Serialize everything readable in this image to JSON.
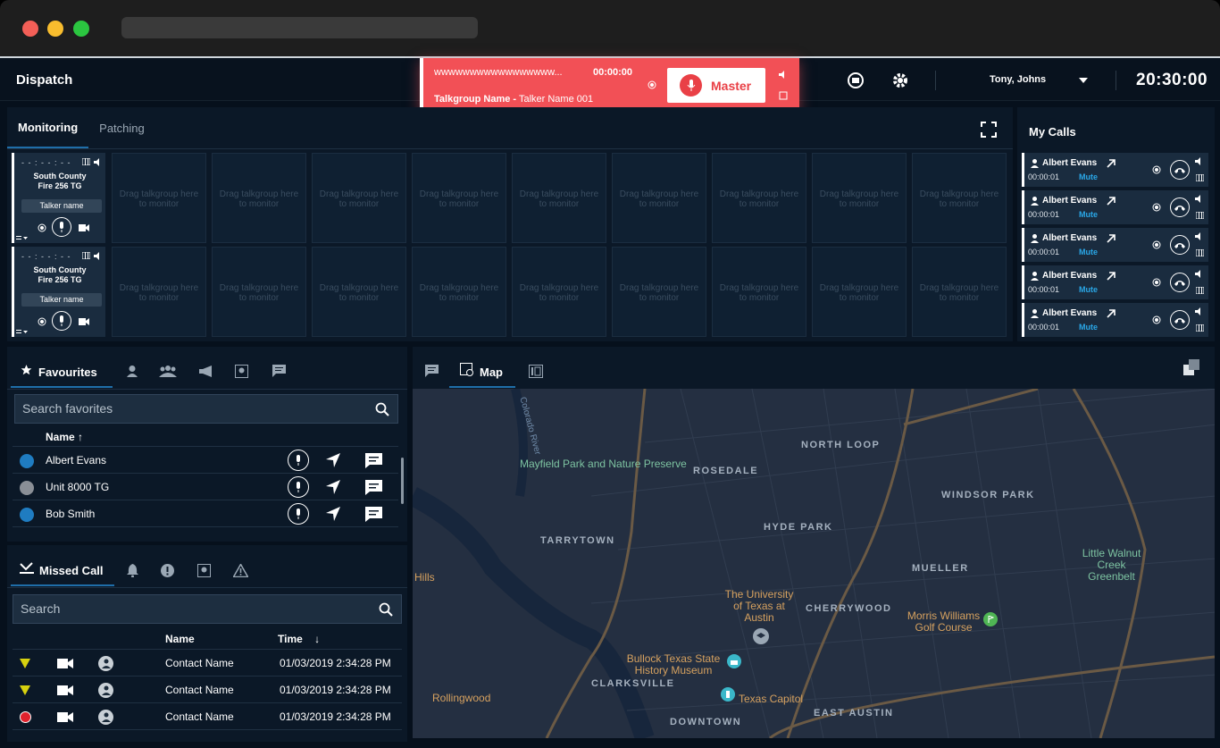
{
  "app": {
    "title": "Dispatch"
  },
  "header": {
    "user": "Tony, Johns",
    "clock": "20:30:00"
  },
  "active_call": {
    "number": "wwwwwwwwwwwwwwwww...",
    "timer": "00:00:00",
    "talkgroup_label": "Talkgroup Name -",
    "talker": "Talker Name 001",
    "master_label": "Master"
  },
  "monitoring": {
    "tabs": [
      {
        "label": "Monitoring"
      },
      {
        "label": "Patching"
      }
    ],
    "active_tiles": [
      {
        "timer": "- - : - - : - -",
        "name_line1": "South County",
        "name_line2": "Fire 256 TG",
        "talker": "Talker name"
      },
      {
        "timer": "- - : - - : - -",
        "name_line1": "South County",
        "name_line2": "Fire 256 TG",
        "talker": "Talker name"
      }
    ],
    "empty_tile_line1": "Drag talkgroup here",
    "empty_tile_line2": "to monitor"
  },
  "my_calls": {
    "title": "My Calls",
    "items": [
      {
        "name": "Albert Evans",
        "duration": "00:00:01",
        "mute": "Mute"
      },
      {
        "name": "Albert Evans",
        "duration": "00:00:01",
        "mute": "Mute"
      },
      {
        "name": "Albert Evans",
        "duration": "00:00:01",
        "mute": "Mute"
      },
      {
        "name": "Albert Evans",
        "duration": "00:00:01",
        "mute": "Mute"
      },
      {
        "name": "Albert Evans",
        "duration": "00:00:01",
        "mute": "Mute"
      }
    ]
  },
  "favourites": {
    "tab_label": "Favourites",
    "search_placeholder": "Search favorites",
    "column_name": "Name",
    "rows": [
      {
        "name": "Albert Evans",
        "color": "#1f7cc1"
      },
      {
        "name": "Unit 8000 TG",
        "color": "#8a8f96"
      },
      {
        "name": "Bob Smith",
        "color": "#1f7cc1"
      }
    ]
  },
  "missed": {
    "tab_label": "Missed Call",
    "search_placeholder": "Search",
    "columns": {
      "name": "Name",
      "time": "Time"
    },
    "rows": [
      {
        "name": "Contact Name",
        "time": "01/03/2019 2:34:28 PM",
        "marker": "triangle"
      },
      {
        "name": "Contact Name",
        "time": "01/03/2019 2:34:28 PM",
        "marker": "triangle"
      },
      {
        "name": "Contact Name",
        "time": "01/03/2019 2:34:28 PM",
        "marker": "circle"
      }
    ]
  },
  "map": {
    "tab_label": "Map",
    "labels": {
      "mayfield": "Mayfield Park and Nature Preserve",
      "rosedale": "ROSEDALE",
      "north_loop": "NORTH LOOP",
      "windsor": "WINDSOR PARK",
      "hyde": "HYDE PARK",
      "tarrytown": "TARRYTOWN",
      "mueller": "MUELLER",
      "ut": "The University of Texas at Austin",
      "cherrywood": "CHERRYWOOD",
      "morris": "Morris Williams Golf Course",
      "walnut": "Little Walnut Creek Greenbelt",
      "bullock": "Bullock Texas State History Museum",
      "clarksville": "CLARKSVILLE",
      "rollingwood": "Rollingwood",
      "capitol": "Texas Capitol",
      "downtown": "DOWNTOWN",
      "east_austin": "EAST AUSTIN",
      "hills": "Hills",
      "river": "Colorado River"
    }
  },
  "colors": {
    "accent": "#1f6ea9",
    "alert": "#f25056",
    "link": "#2aa8e8",
    "warning": "#d7d10f",
    "missed": "#e0222d"
  }
}
